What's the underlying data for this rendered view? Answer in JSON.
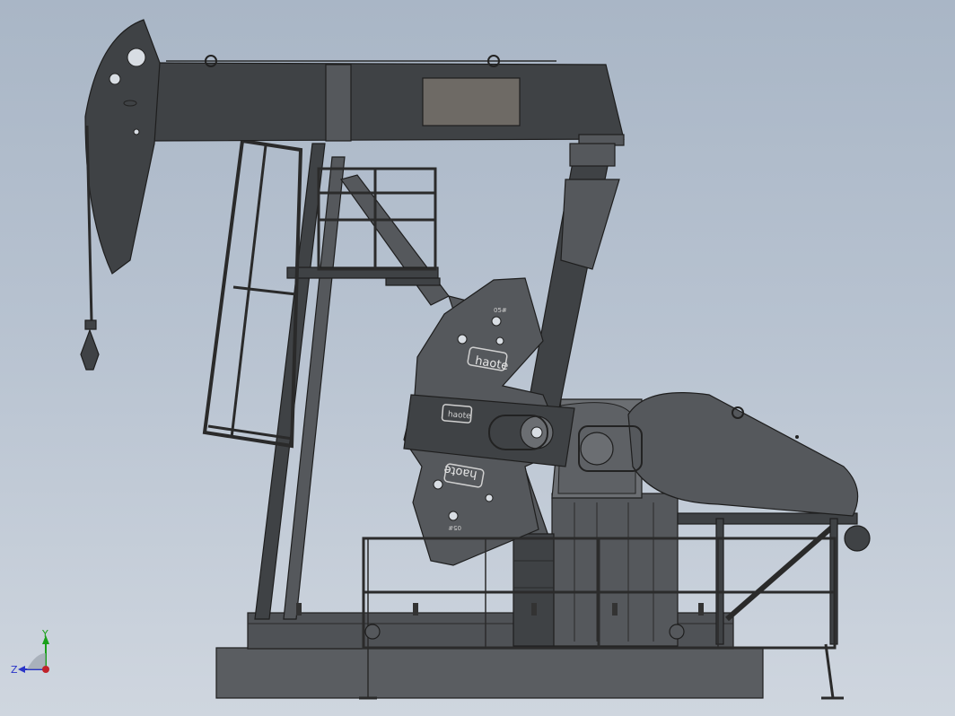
{
  "brand_labels": [
    "haote",
    "haote",
    "haote"
  ],
  "counterweight_marks": [
    "05#",
    "05#"
  ],
  "triad": {
    "y_label": "Y",
    "z_label": "Z",
    "y_color": "#1aa01a",
    "z_color": "#2a35c8",
    "origin_color": "#c0222a"
  }
}
